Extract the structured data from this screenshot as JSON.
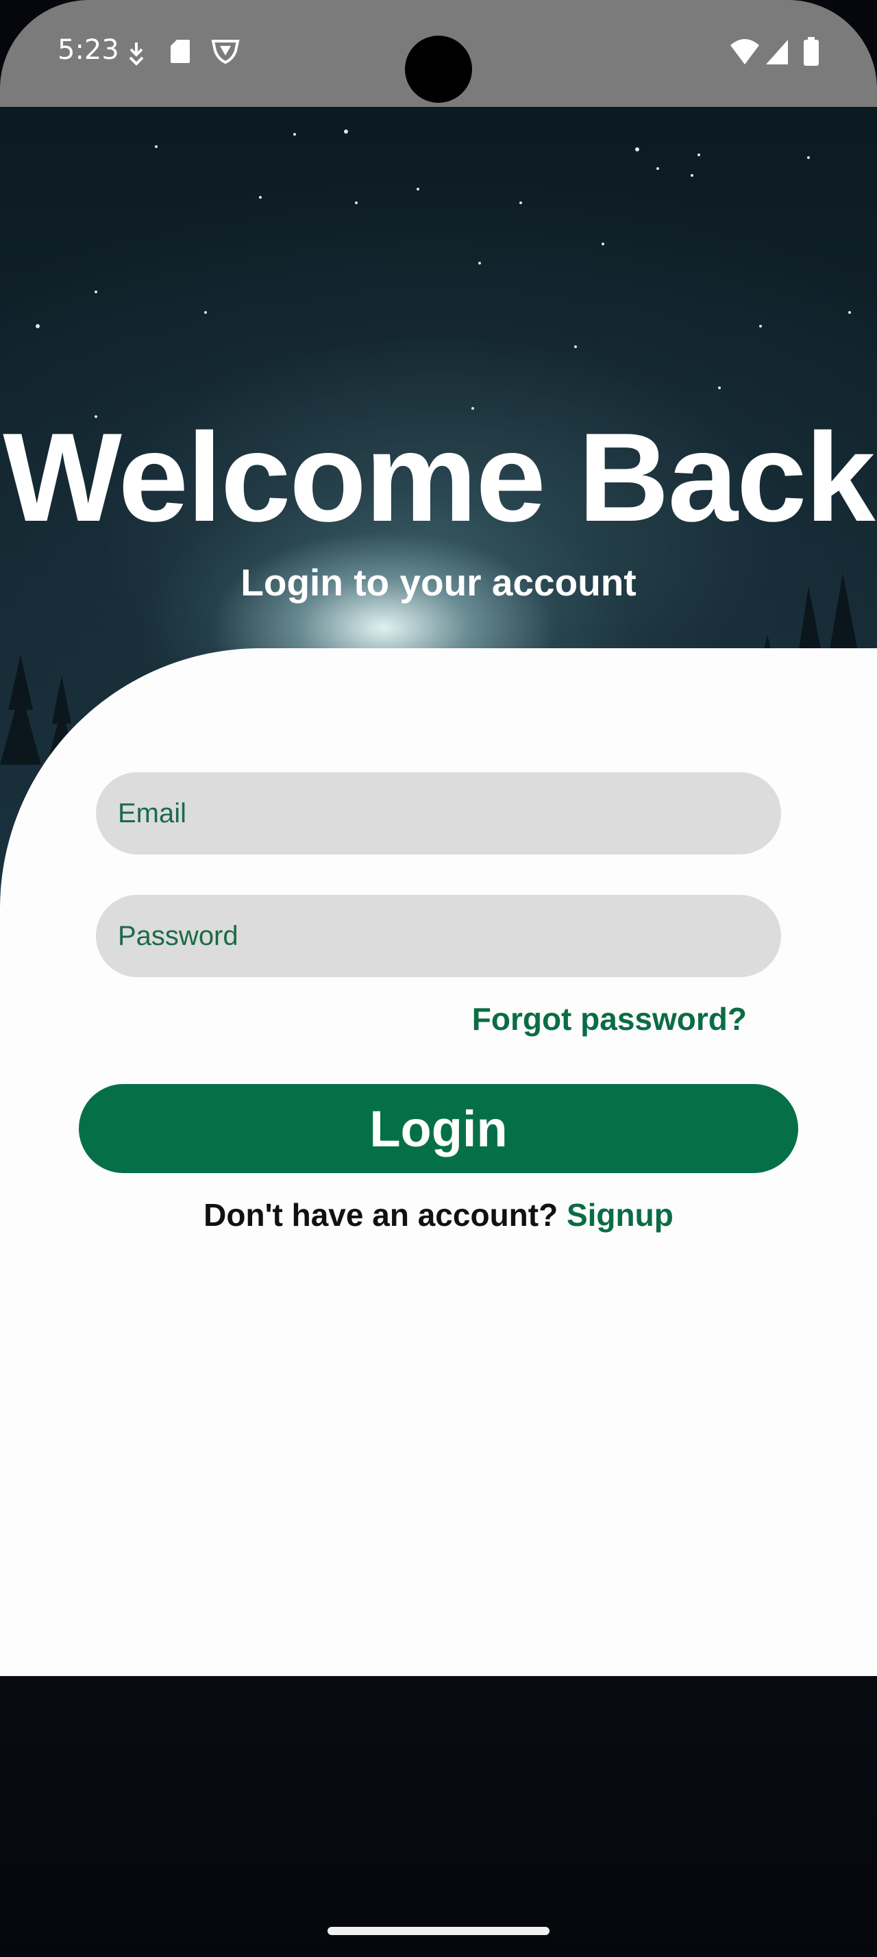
{
  "status_bar": {
    "time": "5:23",
    "left_icons": [
      "download-icon",
      "sd-card-icon",
      "vpn-shield-icon"
    ],
    "right_icons": [
      "wifi-icon",
      "cell-signal-icon",
      "battery-icon"
    ]
  },
  "hero": {
    "title": "Welcome Back",
    "subtitle": "Login to your account"
  },
  "form": {
    "email_placeholder": "Email",
    "password_placeholder": "Password",
    "forgot_password": "Forgot password?",
    "login_label": "Login",
    "signup_prompt": "Don't have an account? ",
    "signup_link": "Signup"
  },
  "colors": {
    "accent": "#057048",
    "link": "#0a6c45",
    "field_bg": "#dcdcdc",
    "card_bg": "#fdfdfd",
    "status_bar_bg": "#7b7b7b"
  }
}
